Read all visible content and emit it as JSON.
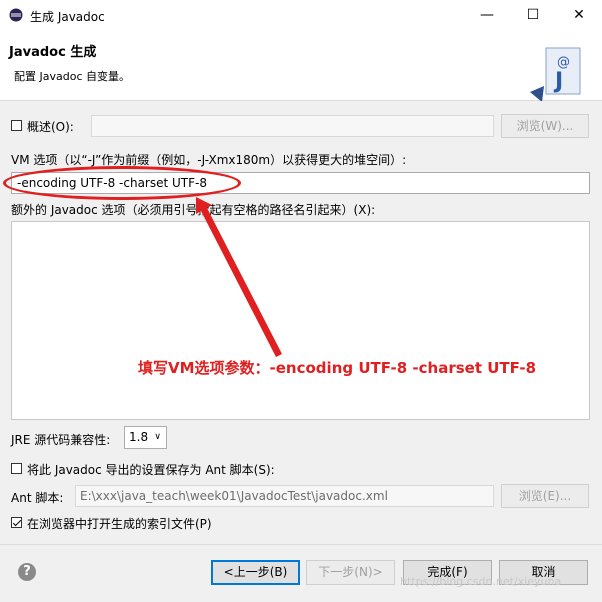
{
  "window": {
    "title": "生成 Javadoc",
    "minimize": "—",
    "maximize": "☐",
    "close": "✕"
  },
  "header": {
    "title": "Javadoc 生成",
    "description": "配置 Javadoc 自变量。",
    "icon_glyph": "J",
    "icon_at": "@"
  },
  "overview": {
    "label": "概述(O):",
    "checked": false,
    "value": "",
    "browse_label": "浏览(W)..."
  },
  "vm_options": {
    "label": "VM 选项（以“-J”作为前缀（例如，-J-Xmx180m）以获得更大的堆空间）:",
    "value": "-encoding UTF-8 -charset UTF-8"
  },
  "extra_options": {
    "label": "额外的 Javadoc 选项（必须用引号括起有空格的路径名引起来）(X):",
    "value": ""
  },
  "jre": {
    "label": "JRE 源代码兼容性:",
    "selected": "1.8"
  },
  "save_ant": {
    "label": "将此 Javadoc 导出的设置保存为 Ant 脚本(S):",
    "checked": false
  },
  "ant_script": {
    "label": "Ant 脚本:",
    "value": "E:\\xxx\\java_teach\\week01\\JavadocTest\\javadoc.xml",
    "browse_label": "浏览(E)..."
  },
  "open_browser": {
    "label": "在浏览器中打开生成的索引文件(P)",
    "checked": true
  },
  "footer": {
    "help_glyph": "?",
    "back_label": "<上一步(B)",
    "next_label": "下一步(N)>",
    "finish_label": "完成(F)",
    "cancel_label": "取消"
  },
  "annotation": {
    "text": "填写VM选项参数：-encoding UTF-8  -charset UTF-8",
    "color": "#e02020"
  },
  "watermark": "https://blog.csdn.net/xieyuna"
}
